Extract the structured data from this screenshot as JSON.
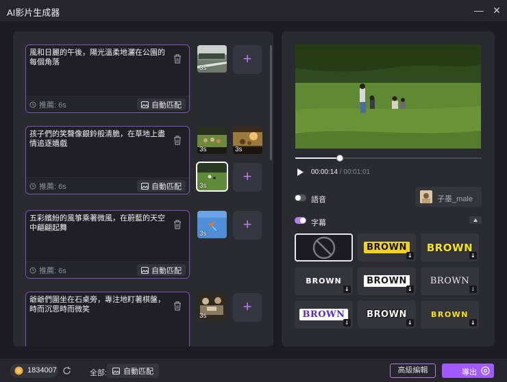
{
  "window": {
    "title": "AI影片生成器",
    "close_label": "✕",
    "minimize_label": "—"
  },
  "scenes": [
    {
      "text": "風和日麗的午後，陽光溫柔地灑在公園的每個角落",
      "duration": "推薦: 6s",
      "match_label": "自動匹配",
      "clips": [
        "3s"
      ]
    },
    {
      "text": "孩子們的笑聲像銀鈴般清脆，在草地上盡情追逐嬉戲",
      "duration": "推薦: 6s",
      "match_label": "自動匹配",
      "clips": [
        "3s",
        "3s",
        "3s"
      ]
    },
    {
      "text": "五彩繽紛的風箏乘著微風，在蔚藍的天空中翩翩起舞",
      "duration": "推薦: 6s",
      "match_label": "自動匹配",
      "clips": [
        "3s"
      ]
    },
    {
      "text": "爺爺們圍坐在石桌旁，專注地盯著棋盤，時而沉思時而微笑",
      "duration": "",
      "match_label": "",
      "clips": [
        "3s"
      ]
    }
  ],
  "player": {
    "current_time": "00:00:14",
    "separator": "/",
    "total_time": "00:01:01",
    "progress": 0.24
  },
  "voice": {
    "label": "語音",
    "enabled": false,
    "voice_name": "子墨_male"
  },
  "subtitle": {
    "label": "字幕",
    "enabled": true,
    "styles": [
      "BROWN",
      "BROWN",
      "BROWN",
      "BROWN",
      "BROWN",
      "BROWN",
      "BROWN",
      "BROWN"
    ]
  },
  "bottom": {
    "credits": "1834007",
    "all_label": "全部:",
    "auto_match_label": "自動匹配",
    "advanced_edit_label": "高級編輯",
    "export_label": "導出"
  },
  "colors": {
    "accent": "#a259ff",
    "accent_border": "#7d55b8",
    "background": "#1c1c22",
    "panel": "#2a2a31"
  }
}
